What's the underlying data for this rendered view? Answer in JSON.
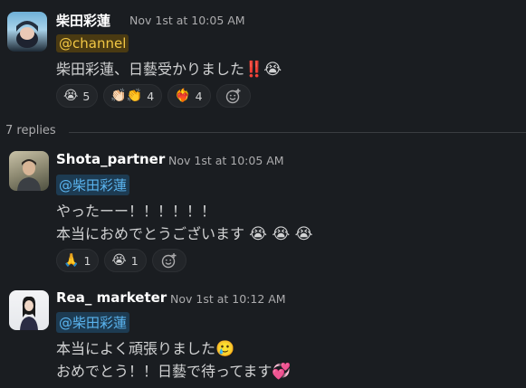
{
  "messages": [
    {
      "author": "柴田彩蓮",
      "timestamp": "Nov 1st at 10:05 AM",
      "mention": "@channel",
      "lines": [
        "柴田彩蓮、日藝受かりました",
        "‼️",
        "😭"
      ],
      "reactions": [
        {
          "emoji": "😭",
          "count": "5"
        },
        {
          "emoji": "👏🏻👏",
          "count": "4"
        },
        {
          "emoji": "❤️‍🔥",
          "count": "4"
        }
      ]
    },
    {
      "author": "Shota_partner",
      "timestamp": "Nov 1st at 10:05 AM",
      "mention": "@柴田彩蓮",
      "line1": "やったーー！！！！！！",
      "line2": "本当におめでとうございます",
      "line2_emoji": "😭 😭 😭",
      "reactions": [
        {
          "emoji": "🙏",
          "count": "1"
        },
        {
          "emoji": "😭",
          "count": "1"
        }
      ]
    },
    {
      "author": "Rea_ marketer",
      "timestamp": "Nov 1st at 10:12 AM",
      "mention": "@柴田彩蓮",
      "line1": "本当によく頑張りました",
      "line1_emoji": "🥲",
      "line2": "おめでとう！！日藝で待ってます",
      "line2_emoji": "💞"
    }
  ],
  "thread": {
    "replies_label": "7 replies"
  },
  "icons": {
    "add_reaction": "add-reaction-icon"
  },
  "colors": {
    "background": "#1a1d21",
    "mention_channel_bg": "#4a3a12",
    "mention_channel_fg": "#f2c744",
    "mention_user_bg": "#1d3b52",
    "mention_user_fg": "#5ab4ef"
  }
}
